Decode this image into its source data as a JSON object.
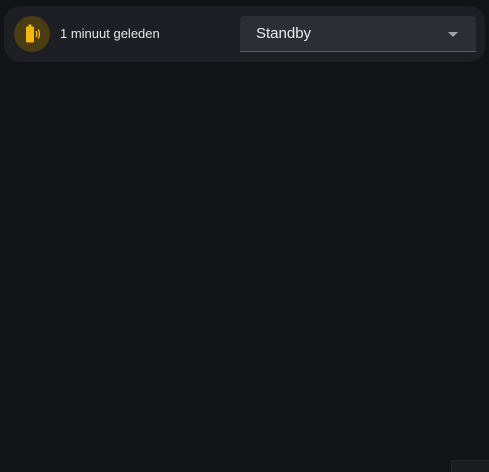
{
  "status_card": {
    "icon": "battery-vibrate-icon",
    "icon_color": "#f3b70f",
    "time_label": "1 minuut geleden"
  },
  "mode_select": {
    "selected": "Standby"
  },
  "colors": {
    "background": "#111317",
    "card": "#1d1f24",
    "select": "#2b2e34",
    "accent": "#f3b70f"
  }
}
